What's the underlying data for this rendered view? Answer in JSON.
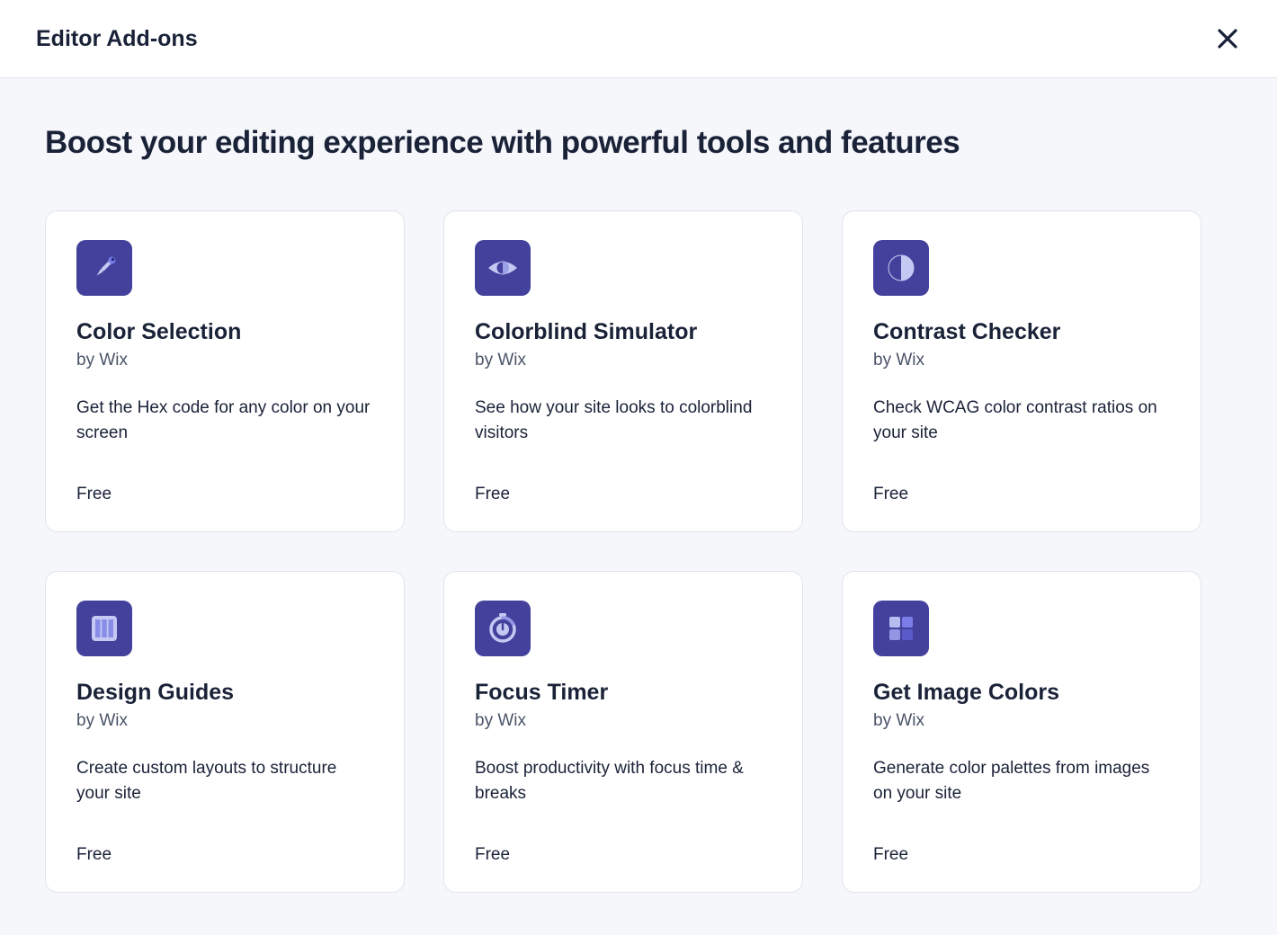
{
  "header": {
    "title": "Editor Add-ons"
  },
  "headline": "Boost your editing experience with powerful tools and features",
  "cards": [
    {
      "icon": "eyedropper-icon",
      "title": "Color Selection",
      "author": "by Wix",
      "description": "Get the Hex code for any color on your screen",
      "price": "Free"
    },
    {
      "icon": "eye-icon",
      "title": "Colorblind Simulator",
      "author": "by Wix",
      "description": "See how your site looks to colorblind visitors",
      "price": "Free"
    },
    {
      "icon": "contrast-icon",
      "title": "Contrast Checker",
      "author": "by Wix",
      "description": "Check WCAG color contrast ratios on your site",
      "price": "Free"
    },
    {
      "icon": "columns-icon",
      "title": "Design Guides",
      "author": "by Wix",
      "description": "Create custom layouts to structure your site",
      "price": "Free"
    },
    {
      "icon": "timer-icon",
      "title": "Focus Timer",
      "author": "by Wix",
      "description": "Boost productivity with focus time & breaks",
      "price": "Free"
    },
    {
      "icon": "palette-grid-icon",
      "title": "Get Image Colors",
      "author": "by Wix",
      "description": "Generate color palettes from images on your site",
      "price": "Free"
    }
  ]
}
